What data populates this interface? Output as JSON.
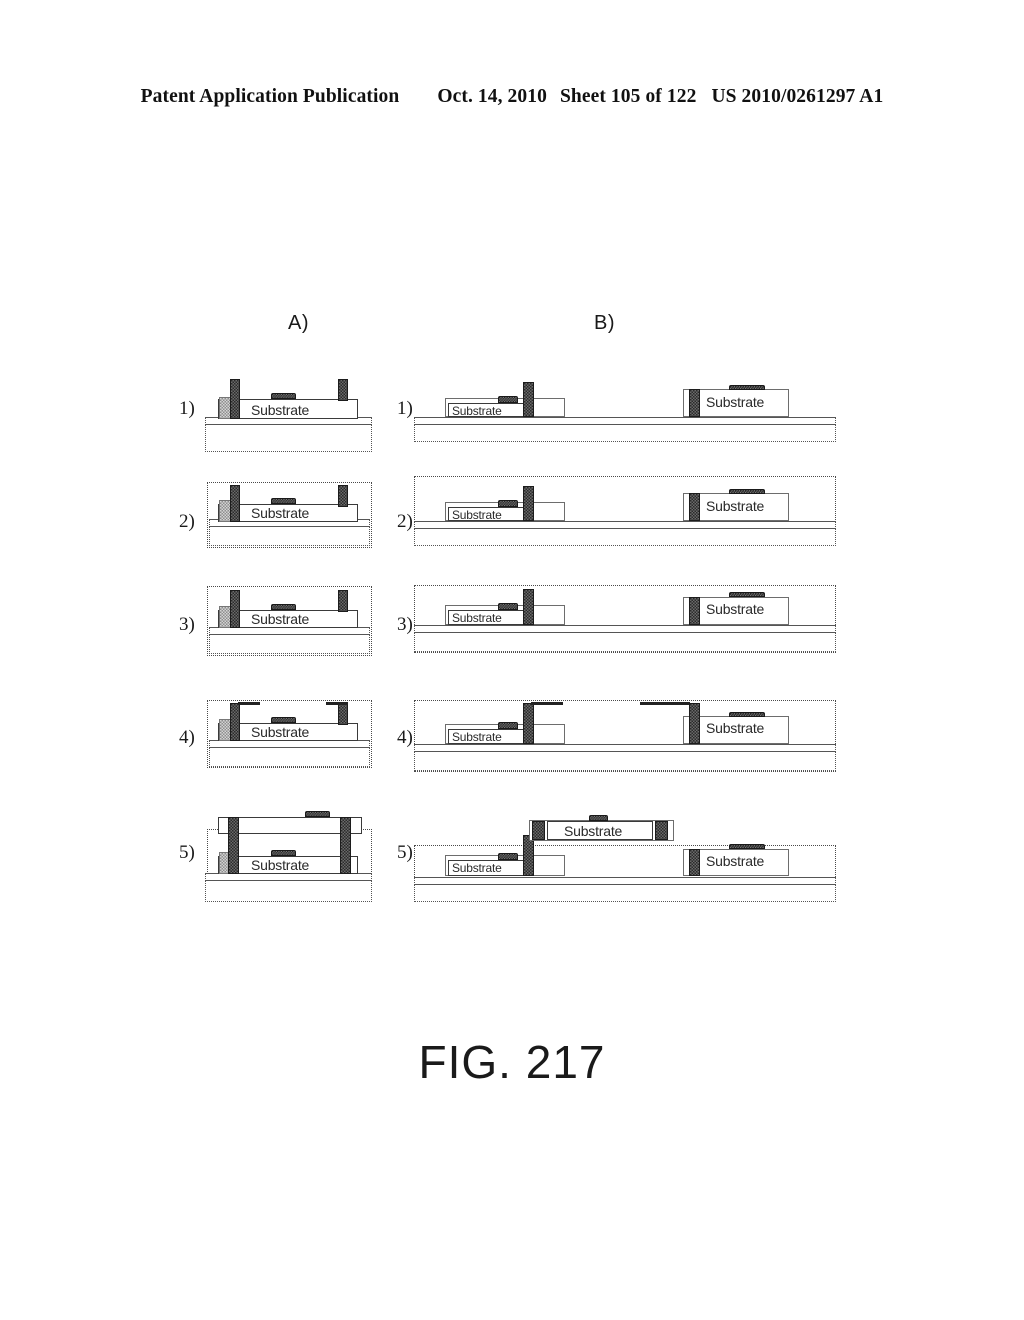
{
  "header": {
    "publication": "Patent Application Publication",
    "date": "Oct. 14, 2010",
    "sheet": "Sheet 105 of 122",
    "patent_number": "US 2010/0261297 A1"
  },
  "figure": {
    "caption": "FIG. 217",
    "columns": [
      {
        "id": "A",
        "label": "A)"
      },
      {
        "id": "B",
        "label": "B)"
      }
    ],
    "row_labels": [
      "1)",
      "2)",
      "3)",
      "4)",
      "5)"
    ],
    "substrate_label": "Substrate",
    "colors": {
      "ink": "#1a1a1a",
      "pillar_dark": "#2b2b2b",
      "pad_grey": "#d4d4d4",
      "outline": "#3a3a3a",
      "paper": "#ffffff"
    }
  },
  "panel_a": {
    "label": "A)",
    "description": "Single-die wafer-level stacking sequence, five steps",
    "steps": [
      {
        "label": "1)",
        "has_outer_frame": false,
        "layers": 1,
        "elements": [
          "base-slab",
          "substrate-die",
          "left-pillar",
          "right-pillar",
          "top-bump",
          "left-pad"
        ]
      },
      {
        "label": "2)",
        "has_outer_frame": true,
        "layers": 1,
        "elements": [
          "outer-frame",
          "base-slab",
          "substrate-die",
          "left-pillar",
          "right-pillar",
          "top-bump",
          "left-pad"
        ]
      },
      {
        "label": "3)",
        "has_outer_frame": true,
        "layers": 1,
        "elements": [
          "outer-frame",
          "base-slab",
          "substrate-die",
          "left-pillar",
          "right-pillar",
          "top-bump",
          "left-pad"
        ]
      },
      {
        "label": "4)",
        "has_outer_frame": true,
        "layers": 1,
        "elements": [
          "outer-frame",
          "base-slab",
          "substrate-die",
          "left-pillar",
          "right-pillar",
          "top-bump",
          "left-pad",
          "top-trace"
        ]
      },
      {
        "label": "5)",
        "has_outer_frame": true,
        "layers": 2,
        "elements": [
          "outer-frame",
          "base-slab",
          "substrate-die",
          "left-pillar",
          "right-pillar",
          "top-bump",
          "left-pad",
          "second-tier-die",
          "second-tier-bump"
        ]
      }
    ]
  },
  "panel_b": {
    "label": "B)",
    "description": "Two-die side-by-side wafer-level stacking sequence, five steps",
    "steps": [
      {
        "label": "1)",
        "has_outer_frame": false,
        "layers": 1,
        "elements": [
          "base-slab",
          "left-die",
          "left-pillar",
          "left-bump",
          "right-die",
          "right-pillar",
          "right-bump"
        ]
      },
      {
        "label": "2)",
        "has_outer_frame": true,
        "layers": 1,
        "elements": [
          "outer-frame",
          "base-slab",
          "left-die",
          "left-pillar",
          "left-bump",
          "right-die",
          "right-pillar",
          "right-bump"
        ]
      },
      {
        "label": "3)",
        "has_outer_frame": true,
        "layers": 1,
        "elements": [
          "outer-frame",
          "base-slab",
          "left-die",
          "left-pillar",
          "left-bump",
          "right-die",
          "right-pillar",
          "right-bump"
        ]
      },
      {
        "label": "4)",
        "has_outer_frame": true,
        "layers": 1,
        "elements": [
          "outer-frame",
          "base-slab",
          "left-die",
          "left-pillar",
          "left-bump",
          "right-die",
          "right-pillar",
          "right-bump",
          "top-trace"
        ]
      },
      {
        "label": "5)",
        "has_outer_frame": true,
        "layers": 2,
        "elements": [
          "outer-frame",
          "base-slab",
          "left-die",
          "left-pillar",
          "left-bump",
          "right-die",
          "right-pillar",
          "right-bump",
          "second-tier-die",
          "second-tier-pillars",
          "second-tier-bump"
        ]
      }
    ]
  }
}
